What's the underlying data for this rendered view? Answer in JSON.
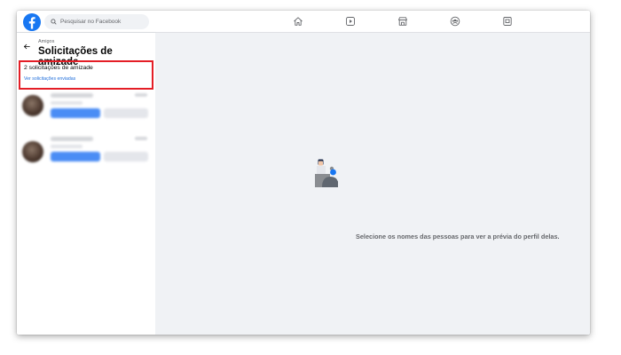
{
  "search": {
    "placeholder": "Pesquisar no Facebook"
  },
  "nav": {
    "icons": [
      "home-icon",
      "watch-icon",
      "marketplace-icon",
      "groups-icon",
      "gaming-icon"
    ]
  },
  "sidebar": {
    "breadcrumb": "Amigos",
    "title": "Solicitações de amizade",
    "request_count": "2 solicitações de amizade",
    "sent_link": "Ver solicitações enviadas"
  },
  "main": {
    "empty_message": "Selecione os nomes das pessoas para ver a prévia do perfil delas."
  },
  "colors": {
    "brand": "#1877f2",
    "highlight": "#e41e26",
    "link": "#216fdb"
  }
}
